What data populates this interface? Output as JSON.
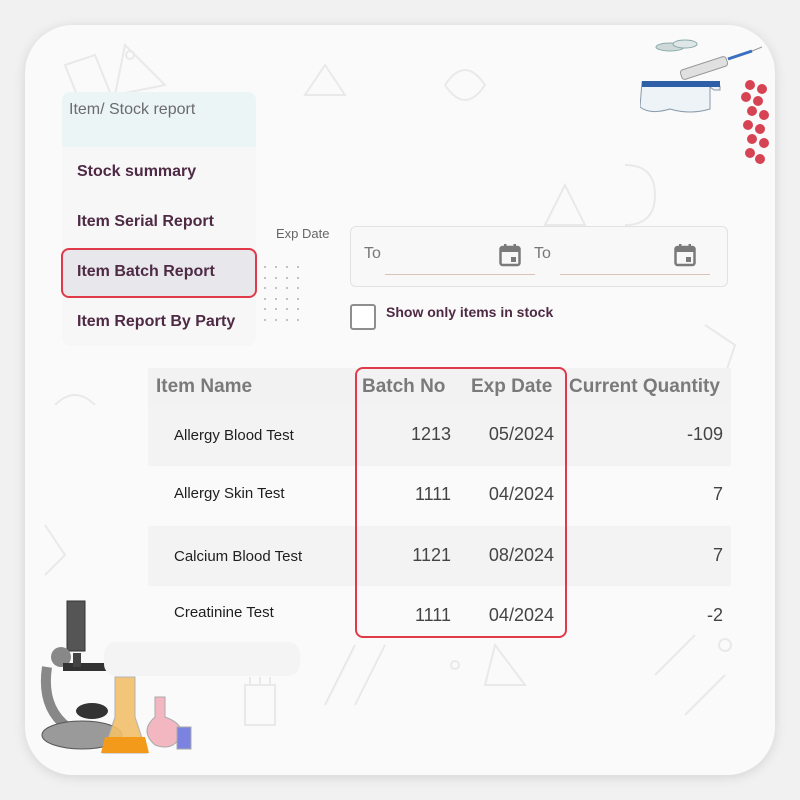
{
  "panel": {
    "title": "Item/ Stock report",
    "items": [
      {
        "label": "Stock summary",
        "active": false
      },
      {
        "label": "Item Serial Report",
        "active": false
      },
      {
        "label": "Item Batch Report",
        "active": true
      },
      {
        "label": "Item Report By Party",
        "active": false
      }
    ]
  },
  "filters": {
    "exp_date_label": "Exp Date",
    "from_field": {
      "label": "To",
      "value": "",
      "icon": "calendar-icon"
    },
    "to_field": {
      "label": "To",
      "value": "",
      "icon": "calendar-icon"
    },
    "in_stock_checkbox": {
      "label": "Show only items in stock",
      "checked": false
    }
  },
  "table": {
    "headers": [
      "Item Name",
      "Batch No",
      "Exp Date",
      "Current Quantity"
    ],
    "rows": [
      {
        "item": "Allergy Blood Test",
        "batch": "1213",
        "exp": "05/2024",
        "qty": "-109"
      },
      {
        "item": "Allergy Skin Test",
        "batch": "1111",
        "exp": "04/2024",
        "qty": "7"
      },
      {
        "item": "Calcium Blood Test",
        "batch": "1121",
        "exp": "08/2024",
        "qty": "7"
      },
      {
        "item": "Creatinine Test",
        "batch": "1111",
        "exp": "04/2024",
        "qty": "-2"
      }
    ]
  },
  "colors": {
    "accent_text": "#4e2a45",
    "highlight_border": "#e03a4a",
    "panel_header_bg": "#ecf5f6"
  },
  "decorations": [
    "petri-dish-icon",
    "syringe-icon",
    "safety-goggles-icon",
    "dna-helix-icon",
    "microscope-icon",
    "flask-icon"
  ]
}
